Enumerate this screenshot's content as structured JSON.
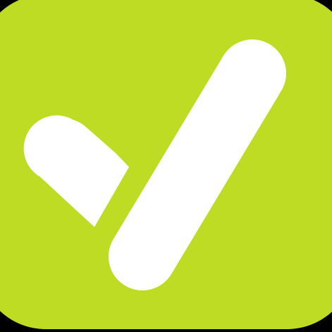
{
  "icon": {
    "name": "checkmark-app-icon",
    "background_color": "#BEDC23",
    "glyph_color": "#FFFFFF",
    "page_background": "#000000"
  }
}
